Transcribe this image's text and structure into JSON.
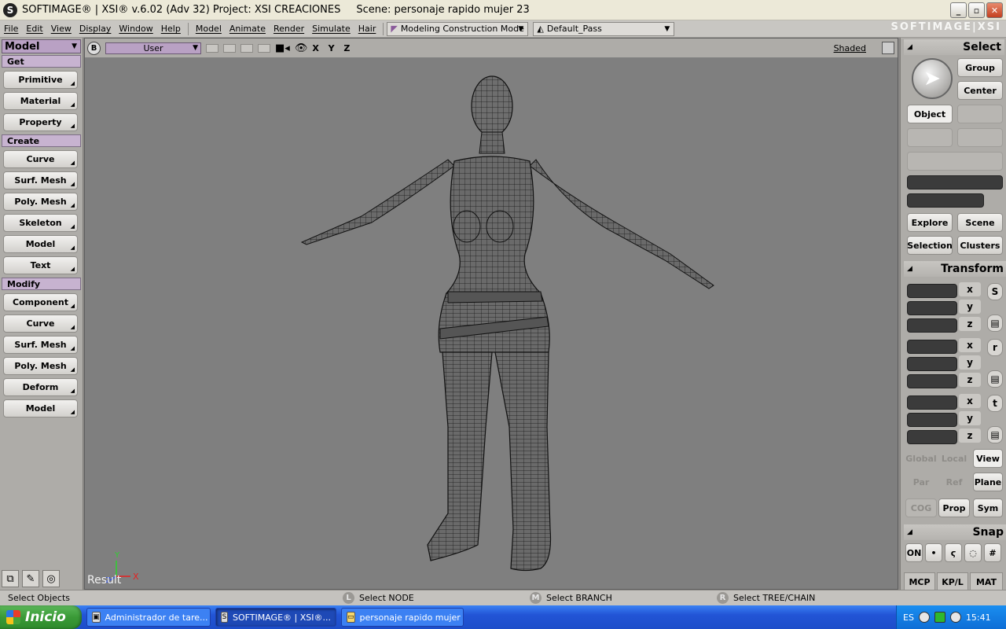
{
  "window": {
    "title": "SOFTIMAGE® | XSI® v.6.02 (Adv 32) Project: XSI CREACIONES",
    "scene": "Scene: personaje rapido mujer 23",
    "brand": "SOFTIMAGE|XSI"
  },
  "menu": {
    "items": [
      "File",
      "Edit",
      "View",
      "Display",
      "Window",
      "Help"
    ],
    "items2": [
      "Model",
      "Animate",
      "Render",
      "Simulate",
      "Hair"
    ],
    "mode": "Modeling Construction Mode",
    "pass": "Default_Pass"
  },
  "left": {
    "module": "Model",
    "get_header": "Get",
    "get": [
      "Primitive",
      "Material",
      "Property"
    ],
    "create_header": "Create",
    "create": [
      "Curve",
      "Surf. Mesh",
      "Poly. Mesh",
      "Skeleton",
      "Model",
      "Text"
    ],
    "modify_header": "Modify",
    "modify": [
      "Component",
      "Curve",
      "Surf. Mesh",
      "Poly. Mesh",
      "Deform",
      "Model"
    ]
  },
  "viewport": {
    "camera": "User",
    "b_label": "B",
    "xyz": "X Y Z",
    "shading": "Shaded",
    "result": "Result",
    "axis_x": "X",
    "axis_y": "Y",
    "axis_z": "Z"
  },
  "right": {
    "select_header": "Select",
    "group": "Group",
    "center": "Center",
    "object": "Object",
    "explore": "Explore",
    "scene": "Scene",
    "selection": "Selection",
    "clusters": "Clusters",
    "transform_header": "Transform",
    "x": "x",
    "y": "y",
    "z": "z",
    "s": "S",
    "r": "r",
    "t": "t",
    "global": "Global",
    "local": "Local",
    "view": "View",
    "par": "Par",
    "ref": "Ref",
    "plane": "Plane",
    "cog": "COG",
    "prop": "Prop",
    "sym": "Sym",
    "snap_header": "Snap",
    "on": "ON",
    "mcp": "MCP",
    "kpl": "KP/L",
    "mat": "MAT"
  },
  "status": {
    "main": "Select Objects",
    "l_key": "L",
    "l_text": "Select NODE",
    "m_key": "M",
    "m_text": "Select BRANCH",
    "r_key": "R",
    "r_text": "Select TREE/CHAIN"
  },
  "taskbar": {
    "start": "Inicio",
    "tasks": [
      "Administrador de tare...",
      "SOFTIMAGE® | XSI®...",
      "personaje rapido mujer"
    ],
    "lang": "ES",
    "clock": "15:41"
  }
}
